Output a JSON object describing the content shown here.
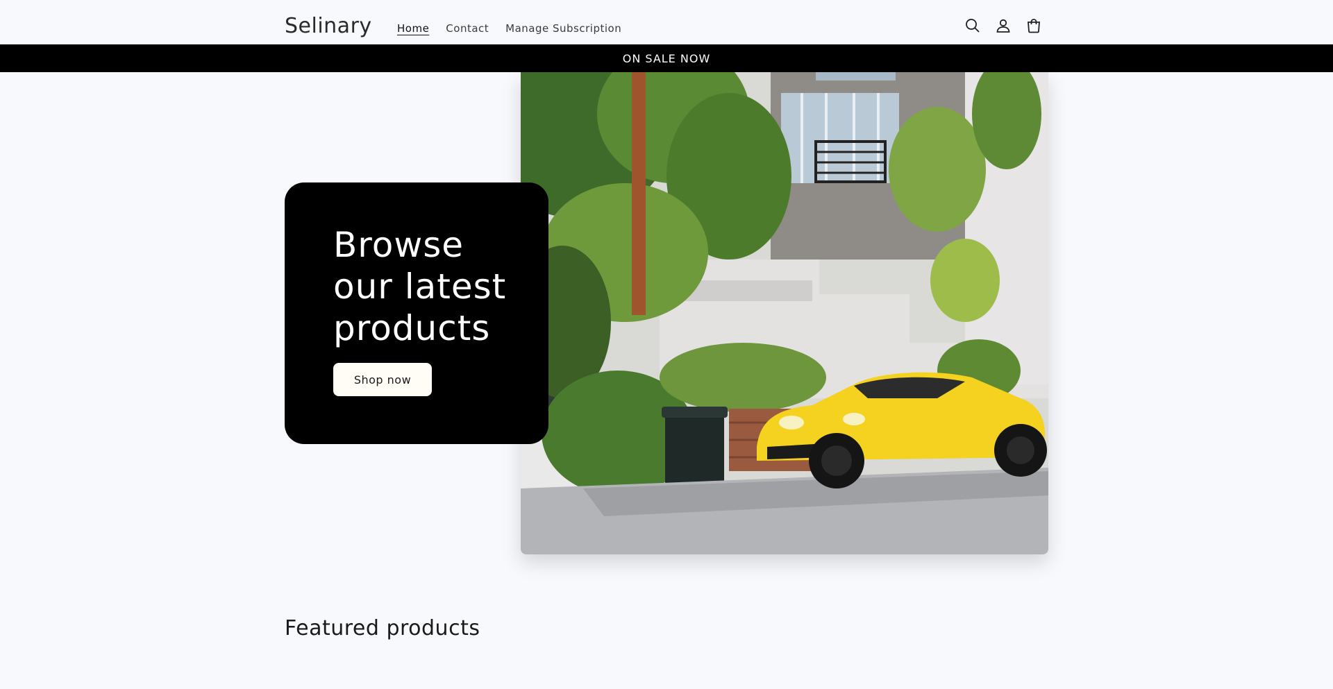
{
  "header": {
    "logo": "Selinary",
    "nav": [
      {
        "label": "Home",
        "active": true
      },
      {
        "label": "Contact",
        "active": false
      },
      {
        "label": "Manage Subscription",
        "active": false
      }
    ],
    "icons": [
      "search-icon",
      "account-icon",
      "cart-icon"
    ]
  },
  "announcement": {
    "text": "ON SALE NOW",
    "background": "#000000",
    "color": "#ffffff"
  },
  "hero": {
    "title": "Browse our latest products",
    "button_label": "Shop now",
    "card_background": "#000000",
    "button_background": "#fffdf6"
  },
  "featured": {
    "title": "Featured products"
  },
  "colors": {
    "page_background": "#f8f9fd",
    "accent_car": "#f4d21f"
  }
}
